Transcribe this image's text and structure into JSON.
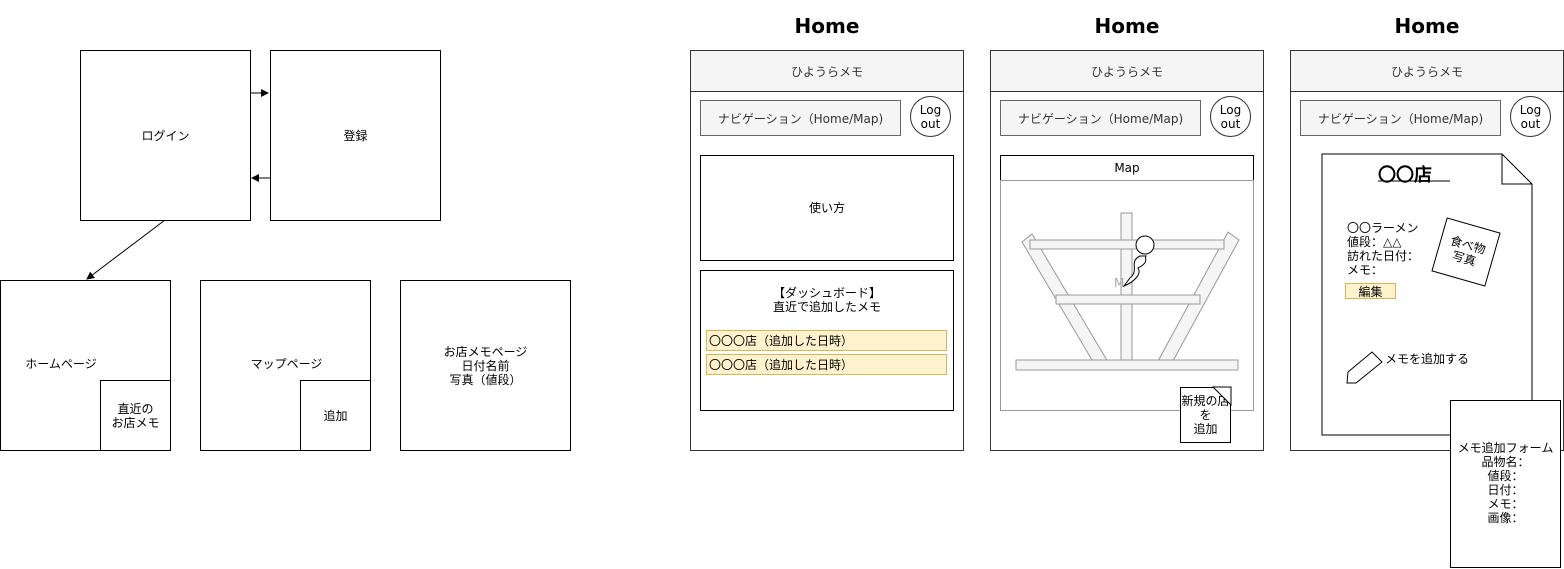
{
  "flow": {
    "login": "ログイン",
    "register": "登録",
    "home_page": "ホームページ",
    "home_recent_line1": "直近の",
    "home_recent_line2": "お店メモ",
    "map_page": "マップページ",
    "map_add": "追加",
    "shop_memo_line1": "お店メモページ",
    "shop_memo_line2": "日付名前",
    "shop_memo_line3": "写真（値段）"
  },
  "screens": [
    {
      "title": "Home",
      "app_title": "ひようらメモ",
      "nav_label": "ナビゲーション（Home/Map)",
      "logout_line1": "Log",
      "logout_line2": "out",
      "howto": "使い方",
      "dashboard_line1": "【ダッシュボード】",
      "dashboard_line2": "直近で追加したメモ",
      "memo_items": [
        "〇〇〇店（追加した日時）",
        "〇〇〇店（追加した日時）"
      ]
    },
    {
      "title": "Home",
      "app_title": "ひようらメモ",
      "nav_label": "ナビゲーション（Home/Map)",
      "logout_line1": "Log",
      "logout_line2": "out",
      "map_label": "Map",
      "map_marker_letter": "M",
      "new_shop_line1": "新規の店",
      "new_shop_line2": "を",
      "new_shop_line3": "追加"
    },
    {
      "title": "Home",
      "app_title": "ひようらメモ",
      "nav_label": "ナビゲーション（Home/Map)",
      "logout_line1": "Log",
      "logout_line2": "out",
      "shop_title": "〇〇店",
      "item_name": "〇〇ラーメン",
      "price": "値段：△△",
      "visited": "訪れた日付：",
      "memo": "メモ：",
      "edit": "編集",
      "photo_line1": "食べ物",
      "photo_line2": "写真",
      "add_memo": "メモを追加する",
      "form_title": "メモ追加フォーム",
      "form_fields": [
        "品物名：",
        "値段：",
        "日付：",
        "メモ：",
        "画像："
      ]
    }
  ],
  "colors": {
    "note_fill": "#fff2cc",
    "note_border": "#d6b656",
    "header_fill": "#f5f5f5",
    "map_road": "#f5f5f5"
  }
}
